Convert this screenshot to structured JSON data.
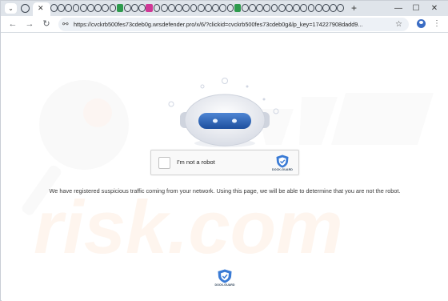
{
  "browser": {
    "tab_menu_glyph": "⌄",
    "tab_close_glyph": "✕",
    "new_tab_glyph": "+",
    "window_controls": {
      "minimize": "—",
      "maximize": "☐",
      "close": "✕"
    },
    "back_glyph": "←",
    "forward_glyph": "→",
    "reload_glyph": "↻",
    "site_info_glyph": "⚯",
    "url": "https://cvckrb500fes73cdeb0g.wrsdefender.pro/x/6/?clickid=cvckrb500fes73cdeb0g&lp_key=174227908dadd9...",
    "bookmark_glyph": "☆",
    "menu_glyph": "⋮",
    "icons": {
      "tab_menu": "chevron-down-icon",
      "favicon_crowd": "spinner-favicon-icon",
      "profile": "profile-avatar-icon"
    },
    "accent_colors": {
      "tabstrip": "#dfe4ea",
      "omnibox": "#edf1f6",
      "favicon_green": "#2e9a4d",
      "favicon_pink": "#d03896"
    }
  },
  "captcha": {
    "checkbox_label": "I'm not a robot",
    "brand": "DOCK-GUARD"
  },
  "message": "We have registered suspicious traffic coming from your network. Using this page, we will be able to determine that you are not the robot.",
  "footer": {
    "brand": "DOCK-GUARD"
  },
  "watermark": {
    "text": "risk.com",
    "color": "#f0ab74"
  }
}
